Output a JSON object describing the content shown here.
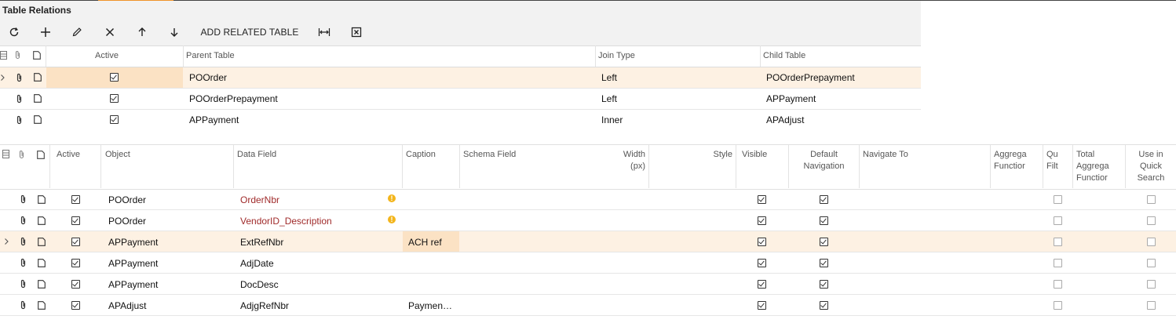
{
  "panel_title": "Table Relations",
  "toolbar": {
    "refresh": "refresh-icon",
    "add": "plus-icon",
    "edit": "pencil-icon",
    "delete": "close-icon",
    "up": "arrow-up-icon",
    "down": "arrow-down-icon",
    "add_related_table": "ADD RELATED TABLE",
    "fit": "fit-width-icon",
    "export": "excel-export-icon"
  },
  "relations": {
    "headers": {
      "active": "Active",
      "parent_table": "Parent Table",
      "join_type": "Join Type",
      "child_table": "Child Table"
    },
    "rows": [
      {
        "active": true,
        "parent_table": "POOrder",
        "join_type": "Left",
        "child_table": "POOrderPrepayment",
        "selected": true
      },
      {
        "active": true,
        "parent_table": "POOrderPrepayment",
        "join_type": "Left",
        "child_table": "APPayment",
        "selected": false
      },
      {
        "active": true,
        "parent_table": "APPayment",
        "join_type": "Inner",
        "child_table": "APAdjust",
        "selected": false
      }
    ]
  },
  "fields": {
    "headers": {
      "active": "Active",
      "object": "Object",
      "data_field": "Data Field",
      "caption": "Caption",
      "schema_field": "Schema Field",
      "width_1": "Width",
      "width_2": "(px)",
      "style": "Style",
      "visible": "Visible",
      "default_nav_1": "Default",
      "default_nav_2": "Navigation",
      "navigate_to": "Navigate To",
      "aggregate_1": "Aggrega",
      "aggregate_2": "Functior",
      "quick_filter_1": "Qu",
      "quick_filter_2": "Filt",
      "total_agg_1": "Total",
      "total_agg_2": "Aggrega",
      "total_agg_3": "Functior",
      "quick_search_1": "Use in",
      "quick_search_2": "Quick",
      "quick_search_3": "Search"
    },
    "rows": [
      {
        "active": true,
        "object": "POOrder",
        "data_field": "OrderNbr",
        "warning": true,
        "caption": "",
        "visible": true,
        "default_nav": true,
        "quick_filter": false,
        "quick_search": false,
        "selected": false
      },
      {
        "active": true,
        "object": "POOrder",
        "data_field": "VendorID_Description",
        "warning": true,
        "caption": "",
        "visible": true,
        "default_nav": true,
        "quick_filter": false,
        "quick_search": false,
        "selected": false
      },
      {
        "active": true,
        "object": "APPayment",
        "data_field": "ExtRefNbr",
        "warning": false,
        "caption": "ACH ref",
        "visible": true,
        "default_nav": true,
        "quick_filter": false,
        "quick_search": false,
        "selected": true
      },
      {
        "active": true,
        "object": "APPayment",
        "data_field": "AdjDate",
        "warning": false,
        "caption": "",
        "visible": true,
        "default_nav": true,
        "quick_filter": false,
        "quick_search": false,
        "selected": false
      },
      {
        "active": true,
        "object": "APPayment",
        "data_field": "DocDesc",
        "warning": false,
        "caption": "",
        "visible": true,
        "default_nav": true,
        "quick_filter": false,
        "quick_search": false,
        "selected": false
      },
      {
        "active": true,
        "object": "APAdjust",
        "data_field": "AdjgRefNbr",
        "warning": false,
        "caption": "Paymen…",
        "visible": true,
        "default_nav": true,
        "quick_filter": false,
        "quick_search": false,
        "selected": false
      }
    ]
  },
  "colors": {
    "accent": "#f0932a",
    "selected_row": "#fdf1e3",
    "link": "#a02b2b",
    "warning": "#f3b51c"
  }
}
